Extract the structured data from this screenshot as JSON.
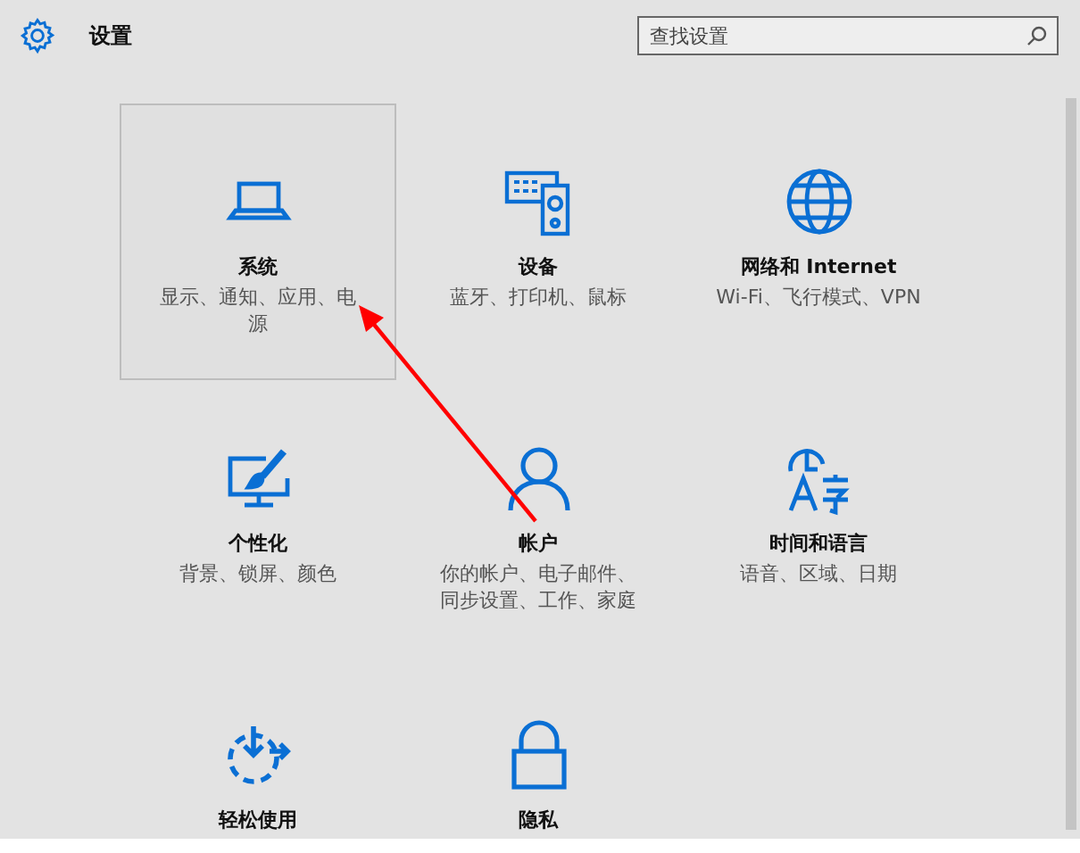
{
  "header": {
    "title": "设置"
  },
  "search": {
    "placeholder": "查找设置"
  },
  "tiles": [
    {
      "title": "系统",
      "description": "显示、通知、应用、电源",
      "selected": true
    },
    {
      "title": "设备",
      "description": "蓝牙、打印机、鼠标",
      "selected": false
    },
    {
      "title": "网络和 Internet",
      "description": "Wi-Fi、飞行模式、VPN",
      "selected": false
    },
    {
      "title": "个性化",
      "description": "背景、锁屏、颜色",
      "selected": false
    },
    {
      "title": "帐户",
      "description": "你的帐户、电子邮件、同步设置、工作、家庭",
      "selected": false
    },
    {
      "title": "时间和语言",
      "description": "语音、区域、日期",
      "selected": false
    },
    {
      "title": "轻松使用",
      "selected": false
    },
    {
      "title": "隐私",
      "selected": false
    }
  ]
}
